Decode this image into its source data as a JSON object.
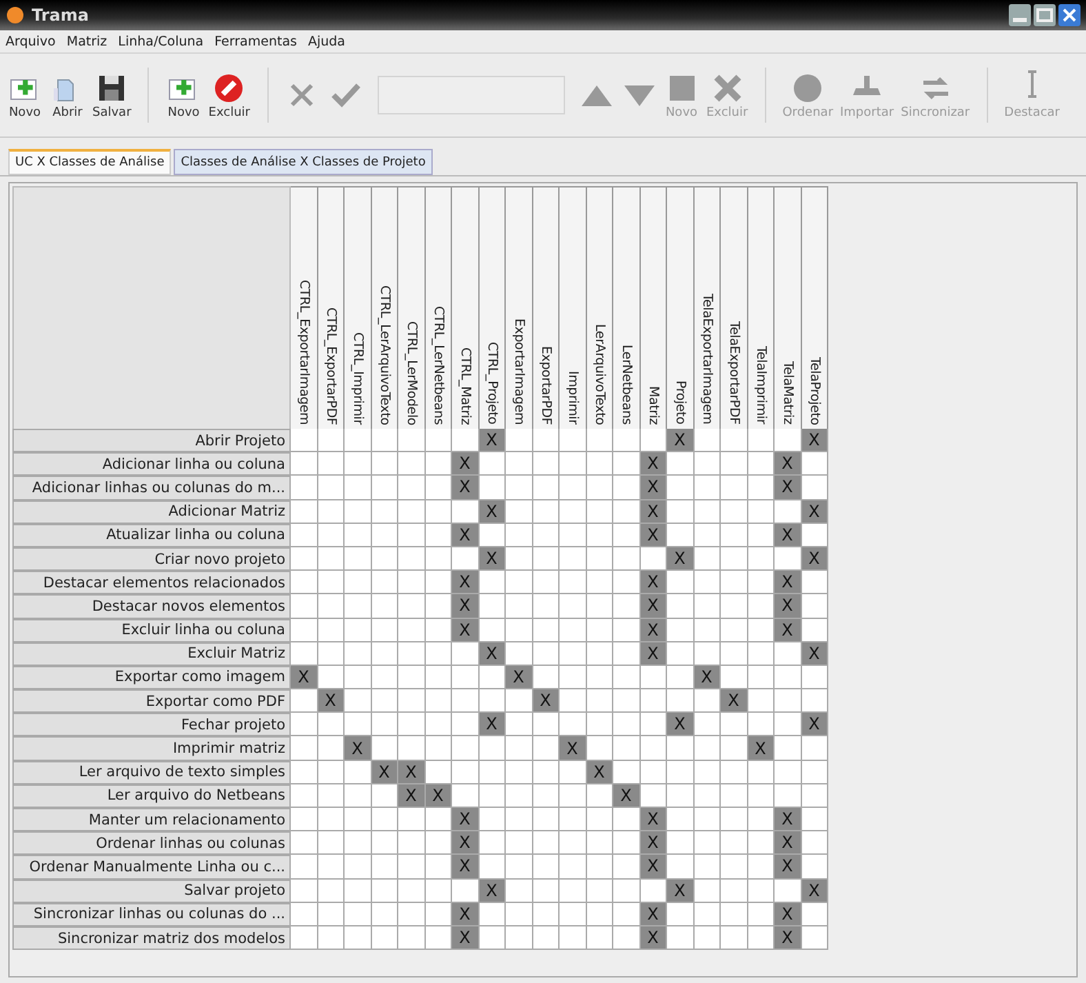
{
  "window": {
    "title": "Trama"
  },
  "menu": [
    "Arquivo",
    "Matriz",
    "Linha/Coluna",
    "Ferramentas",
    "Ajuda"
  ],
  "toolbar": [
    {
      "kind": "button",
      "label": "Novo",
      "disabled": false
    },
    {
      "kind": "button",
      "label": "Abrir",
      "disabled": false
    },
    {
      "kind": "button",
      "label": "Salvar",
      "disabled": false
    },
    {
      "kind": "separator"
    },
    {
      "kind": "button",
      "label": "Novo",
      "disabled": false
    },
    {
      "kind": "button",
      "label": "Excluir",
      "disabled": false
    },
    {
      "kind": "separator"
    },
    {
      "kind": "button",
      "disabled": true
    },
    {
      "kind": "button",
      "disabled": true
    },
    {
      "kind": "field",
      "disabled": true
    },
    {
      "kind": "button",
      "disabled": true
    },
    {
      "kind": "button",
      "disabled": true
    },
    {
      "kind": "button",
      "label": "Novo",
      "disabled": true
    },
    {
      "kind": "button",
      "label": "Excluir",
      "disabled": true
    },
    {
      "kind": "separator"
    },
    {
      "kind": "button",
      "label": "Ordenar",
      "disabled": true
    },
    {
      "kind": "button",
      "label": "Importar",
      "disabled": true
    },
    {
      "kind": "button",
      "label": "Sincronizar",
      "disabled": true
    },
    {
      "kind": "separator"
    },
    {
      "kind": "button",
      "label": "Destacar",
      "disabled": true
    }
  ],
  "tabs": [
    {
      "label": "UC X Classes de Análise",
      "selected": true
    },
    {
      "label": "Classes de Análise X Classes de Projeto",
      "selected": false
    }
  ],
  "matrix": {
    "columns": [
      "CTRL_ExportarImagem",
      "CTRL_ExportarPDF",
      "CTRL_Imprimir",
      "CTRL_LerArquivoTexto",
      "CTRL_LerModelo",
      "CTRL_LerNetbeans",
      "CTRL_Matriz",
      "CTRL_Projeto",
      "ExportarImagem",
      "ExportarPDF",
      "Imprimir",
      "LerArquivoTexto",
      "LerNetbeans",
      "Matriz",
      "Projeto",
      "TelaExportarImagem",
      "TelaExportarPDF",
      "TelaImprimir",
      "TelaMatriz",
      "TelaProjeto"
    ],
    "rows": [
      {
        "label": "Abrir Projeto",
        "cells": [
          {
            "checked": false
          },
          {
            "checked": false
          },
          {
            "checked": false
          },
          {
            "checked": false
          },
          {
            "checked": false
          },
          {
            "checked": false
          },
          {
            "checked": false
          },
          {
            "checked": true,
            "text": "X"
          },
          {
            "checked": false
          },
          {
            "checked": false
          },
          {
            "checked": false
          },
          {
            "checked": false
          },
          {
            "checked": false
          },
          {
            "checked": false
          },
          {
            "checked": true,
            "text": "X"
          },
          {
            "checked": false
          },
          {
            "checked": false
          },
          {
            "checked": false
          },
          {
            "checked": false
          },
          {
            "checked": true,
            "text": "X"
          }
        ]
      },
      {
        "label": "Adicionar linha ou coluna",
        "cells": [
          {
            "checked": false
          },
          {
            "checked": false
          },
          {
            "checked": false
          },
          {
            "checked": false
          },
          {
            "checked": false
          },
          {
            "checked": false
          },
          {
            "checked": true,
            "text": "X"
          },
          {
            "checked": false
          },
          {
            "checked": false
          },
          {
            "checked": false
          },
          {
            "checked": false
          },
          {
            "checked": false
          },
          {
            "checked": false
          },
          {
            "checked": true,
            "text": "X"
          },
          {
            "checked": false
          },
          {
            "checked": false
          },
          {
            "checked": false
          },
          {
            "checked": false
          },
          {
            "checked": true,
            "text": "X"
          },
          {
            "checked": false
          }
        ]
      },
      {
        "label": "Adicionar linhas ou colunas do m...",
        "cells": [
          {
            "checked": false
          },
          {
            "checked": false
          },
          {
            "checked": false
          },
          {
            "checked": false
          },
          {
            "checked": false
          },
          {
            "checked": false
          },
          {
            "checked": true,
            "text": "X"
          },
          {
            "checked": false
          },
          {
            "checked": false
          },
          {
            "checked": false
          },
          {
            "checked": false
          },
          {
            "checked": false
          },
          {
            "checked": false
          },
          {
            "checked": true,
            "text": "X"
          },
          {
            "checked": false
          },
          {
            "checked": false
          },
          {
            "checked": false
          },
          {
            "checked": false
          },
          {
            "checked": true,
            "text": "X"
          },
          {
            "checked": false
          }
        ]
      },
      {
        "label": "Adicionar Matriz",
        "cells": [
          {
            "checked": false
          },
          {
            "checked": false
          },
          {
            "checked": false
          },
          {
            "checked": false
          },
          {
            "checked": false
          },
          {
            "checked": false
          },
          {
            "checked": false
          },
          {
            "checked": true,
            "text": "X"
          },
          {
            "checked": false
          },
          {
            "checked": false
          },
          {
            "checked": false
          },
          {
            "checked": false
          },
          {
            "checked": false
          },
          {
            "checked": true,
            "text": "X"
          },
          {
            "checked": false
          },
          {
            "checked": false
          },
          {
            "checked": false
          },
          {
            "checked": false
          },
          {
            "checked": false
          },
          {
            "checked": true,
            "text": "X"
          }
        ]
      },
      {
        "label": "Atualizar linha ou coluna",
        "cells": [
          {
            "checked": false
          },
          {
            "checked": false
          },
          {
            "checked": false
          },
          {
            "checked": false
          },
          {
            "checked": false
          },
          {
            "checked": false
          },
          {
            "checked": true,
            "text": "X"
          },
          {
            "checked": false
          },
          {
            "checked": false
          },
          {
            "checked": false
          },
          {
            "checked": false
          },
          {
            "checked": false
          },
          {
            "checked": false
          },
          {
            "checked": true,
            "text": "X"
          },
          {
            "checked": false
          },
          {
            "checked": false
          },
          {
            "checked": false
          },
          {
            "checked": false
          },
          {
            "checked": true,
            "text": "X"
          },
          {
            "checked": false
          }
        ]
      },
      {
        "label": "Criar novo projeto",
        "cells": [
          {
            "checked": false
          },
          {
            "checked": false
          },
          {
            "checked": false
          },
          {
            "checked": false
          },
          {
            "checked": false
          },
          {
            "checked": false
          },
          {
            "checked": false
          },
          {
            "checked": true,
            "text": "X"
          },
          {
            "checked": false
          },
          {
            "checked": false
          },
          {
            "checked": false
          },
          {
            "checked": false
          },
          {
            "checked": false
          },
          {
            "checked": false
          },
          {
            "checked": true,
            "text": "X"
          },
          {
            "checked": false
          },
          {
            "checked": false
          },
          {
            "checked": false
          },
          {
            "checked": false
          },
          {
            "checked": true,
            "text": "X"
          }
        ]
      },
      {
        "label": "Destacar elementos relacionados",
        "cells": [
          {
            "checked": false
          },
          {
            "checked": false
          },
          {
            "checked": false
          },
          {
            "checked": false
          },
          {
            "checked": false
          },
          {
            "checked": false
          },
          {
            "checked": true,
            "text": "X"
          },
          {
            "checked": false
          },
          {
            "checked": false
          },
          {
            "checked": false
          },
          {
            "checked": false
          },
          {
            "checked": false
          },
          {
            "checked": false
          },
          {
            "checked": true,
            "text": "X"
          },
          {
            "checked": false
          },
          {
            "checked": false
          },
          {
            "checked": false
          },
          {
            "checked": false
          },
          {
            "checked": true,
            "text": "X"
          },
          {
            "checked": false
          }
        ]
      },
      {
        "label": "Destacar novos elementos",
        "cells": [
          {
            "checked": false
          },
          {
            "checked": false
          },
          {
            "checked": false
          },
          {
            "checked": false
          },
          {
            "checked": false
          },
          {
            "checked": false
          },
          {
            "checked": true,
            "text": "X"
          },
          {
            "checked": false
          },
          {
            "checked": false
          },
          {
            "checked": false
          },
          {
            "checked": false
          },
          {
            "checked": false
          },
          {
            "checked": false
          },
          {
            "checked": true,
            "text": "X"
          },
          {
            "checked": false
          },
          {
            "checked": false
          },
          {
            "checked": false
          },
          {
            "checked": false
          },
          {
            "checked": true,
            "text": "X"
          },
          {
            "checked": false
          }
        ]
      },
      {
        "label": "Excluir linha ou coluna",
        "cells": [
          {
            "checked": false
          },
          {
            "checked": false
          },
          {
            "checked": false
          },
          {
            "checked": false
          },
          {
            "checked": false
          },
          {
            "checked": false
          },
          {
            "checked": true,
            "text": "X"
          },
          {
            "checked": false
          },
          {
            "checked": false
          },
          {
            "checked": false
          },
          {
            "checked": false
          },
          {
            "checked": false
          },
          {
            "checked": false
          },
          {
            "checked": true,
            "text": "X"
          },
          {
            "checked": false
          },
          {
            "checked": false
          },
          {
            "checked": false
          },
          {
            "checked": false
          },
          {
            "checked": true,
            "text": "X"
          },
          {
            "checked": false
          }
        ]
      },
      {
        "label": "Excluir Matriz",
        "cells": [
          {
            "checked": false
          },
          {
            "checked": false
          },
          {
            "checked": false
          },
          {
            "checked": false
          },
          {
            "checked": false
          },
          {
            "checked": false
          },
          {
            "checked": false
          },
          {
            "checked": true,
            "text": "X"
          },
          {
            "checked": false
          },
          {
            "checked": false
          },
          {
            "checked": false
          },
          {
            "checked": false
          },
          {
            "checked": false
          },
          {
            "checked": true,
            "text": "X"
          },
          {
            "checked": false
          },
          {
            "checked": false
          },
          {
            "checked": false
          },
          {
            "checked": false
          },
          {
            "checked": false
          },
          {
            "checked": true,
            "text": "X"
          }
        ]
      },
      {
        "label": "Exportar como imagem",
        "cells": [
          {
            "checked": true,
            "text": "X"
          },
          {
            "checked": false
          },
          {
            "checked": false
          },
          {
            "checked": false
          },
          {
            "checked": false
          },
          {
            "checked": false
          },
          {
            "checked": false
          },
          {
            "checked": false
          },
          {
            "checked": true,
            "text": "X"
          },
          {
            "checked": false
          },
          {
            "checked": false
          },
          {
            "checked": false
          },
          {
            "checked": false
          },
          {
            "checked": false
          },
          {
            "checked": false
          },
          {
            "checked": true,
            "text": "X"
          },
          {
            "checked": false
          },
          {
            "checked": false
          },
          {
            "checked": false
          },
          {
            "checked": false
          }
        ]
      },
      {
        "label": "Exportar como PDF",
        "cells": [
          {
            "checked": false
          },
          {
            "checked": true,
            "text": "X"
          },
          {
            "checked": false
          },
          {
            "checked": false
          },
          {
            "checked": false
          },
          {
            "checked": false
          },
          {
            "checked": false
          },
          {
            "checked": false
          },
          {
            "checked": false
          },
          {
            "checked": true,
            "text": "X"
          },
          {
            "checked": false
          },
          {
            "checked": false
          },
          {
            "checked": false
          },
          {
            "checked": false
          },
          {
            "checked": false
          },
          {
            "checked": false
          },
          {
            "checked": true,
            "text": "X"
          },
          {
            "checked": false
          },
          {
            "checked": false
          },
          {
            "checked": false
          }
        ]
      },
      {
        "label": "Fechar projeto",
        "cells": [
          {
            "checked": false
          },
          {
            "checked": false
          },
          {
            "checked": false
          },
          {
            "checked": false
          },
          {
            "checked": false
          },
          {
            "checked": false
          },
          {
            "checked": false
          },
          {
            "checked": true,
            "text": "X"
          },
          {
            "checked": false
          },
          {
            "checked": false
          },
          {
            "checked": false
          },
          {
            "checked": false
          },
          {
            "checked": false
          },
          {
            "checked": false
          },
          {
            "checked": true,
            "text": "X"
          },
          {
            "checked": false
          },
          {
            "checked": false
          },
          {
            "checked": false
          },
          {
            "checked": false
          },
          {
            "checked": true,
            "text": "X"
          }
        ]
      },
      {
        "label": "Imprimir matriz",
        "cells": [
          {
            "checked": false
          },
          {
            "checked": false
          },
          {
            "checked": true,
            "text": "X"
          },
          {
            "checked": false
          },
          {
            "checked": false
          },
          {
            "checked": false
          },
          {
            "checked": false
          },
          {
            "checked": false
          },
          {
            "checked": false
          },
          {
            "checked": false
          },
          {
            "checked": true,
            "text": "X"
          },
          {
            "checked": false
          },
          {
            "checked": false
          },
          {
            "checked": false
          },
          {
            "checked": false
          },
          {
            "checked": false
          },
          {
            "checked": false
          },
          {
            "checked": true,
            "text": "X"
          },
          {
            "checked": false
          },
          {
            "checked": false
          }
        ]
      },
      {
        "label": "Ler arquivo de texto simples",
        "cells": [
          {
            "checked": false
          },
          {
            "checked": false
          },
          {
            "checked": false
          },
          {
            "checked": true,
            "text": "X"
          },
          {
            "checked": true,
            "text": "X"
          },
          {
            "checked": false
          },
          {
            "checked": false
          },
          {
            "checked": false
          },
          {
            "checked": false
          },
          {
            "checked": false
          },
          {
            "checked": false
          },
          {
            "checked": true,
            "text": "X"
          },
          {
            "checked": false
          },
          {
            "checked": false
          },
          {
            "checked": false
          },
          {
            "checked": false
          },
          {
            "checked": false
          },
          {
            "checked": false
          },
          {
            "checked": false
          },
          {
            "checked": false
          }
        ]
      },
      {
        "label": "Ler arquivo do Netbeans",
        "cells": [
          {
            "checked": false
          },
          {
            "checked": false
          },
          {
            "checked": false
          },
          {
            "checked": false
          },
          {
            "checked": true,
            "text": "X"
          },
          {
            "checked": true,
            "text": "X"
          },
          {
            "checked": false
          },
          {
            "checked": false
          },
          {
            "checked": false
          },
          {
            "checked": false
          },
          {
            "checked": false
          },
          {
            "checked": false
          },
          {
            "checked": true,
            "text": "X"
          },
          {
            "checked": false
          },
          {
            "checked": false
          },
          {
            "checked": false
          },
          {
            "checked": false
          },
          {
            "checked": false
          },
          {
            "checked": false
          },
          {
            "checked": false
          }
        ]
      },
      {
        "label": "Manter um relacionamento",
        "cells": [
          {
            "checked": false
          },
          {
            "checked": false
          },
          {
            "checked": false
          },
          {
            "checked": false
          },
          {
            "checked": false
          },
          {
            "checked": false
          },
          {
            "checked": true,
            "text": "X"
          },
          {
            "checked": false
          },
          {
            "checked": false
          },
          {
            "checked": false
          },
          {
            "checked": false
          },
          {
            "checked": false
          },
          {
            "checked": false
          },
          {
            "checked": true,
            "text": "X"
          },
          {
            "checked": false
          },
          {
            "checked": false
          },
          {
            "checked": false
          },
          {
            "checked": false
          },
          {
            "checked": true,
            "text": "X"
          },
          {
            "checked": false
          }
        ]
      },
      {
        "label": "Ordenar linhas ou colunas",
        "cells": [
          {
            "checked": false
          },
          {
            "checked": false
          },
          {
            "checked": false
          },
          {
            "checked": false
          },
          {
            "checked": false
          },
          {
            "checked": false
          },
          {
            "checked": true,
            "text": "X"
          },
          {
            "checked": false
          },
          {
            "checked": false
          },
          {
            "checked": false
          },
          {
            "checked": false
          },
          {
            "checked": false
          },
          {
            "checked": false
          },
          {
            "checked": true,
            "text": "X"
          },
          {
            "checked": false
          },
          {
            "checked": false
          },
          {
            "checked": false
          },
          {
            "checked": false
          },
          {
            "checked": true,
            "text": "X"
          },
          {
            "checked": false
          }
        ]
      },
      {
        "label": "Ordenar Manualmente Linha ou c...",
        "cells": [
          {
            "checked": false
          },
          {
            "checked": false
          },
          {
            "checked": false
          },
          {
            "checked": false
          },
          {
            "checked": false
          },
          {
            "checked": false
          },
          {
            "checked": true,
            "text": "X"
          },
          {
            "checked": false
          },
          {
            "checked": false
          },
          {
            "checked": false
          },
          {
            "checked": false
          },
          {
            "checked": false
          },
          {
            "checked": false
          },
          {
            "checked": true,
            "text": "X"
          },
          {
            "checked": false
          },
          {
            "checked": false
          },
          {
            "checked": false
          },
          {
            "checked": false
          },
          {
            "checked": true,
            "text": "X"
          },
          {
            "checked": false
          }
        ]
      },
      {
        "label": "Salvar projeto",
        "cells": [
          {
            "checked": false
          },
          {
            "checked": false
          },
          {
            "checked": false
          },
          {
            "checked": false
          },
          {
            "checked": false
          },
          {
            "checked": false
          },
          {
            "checked": false
          },
          {
            "checked": true,
            "text": "X"
          },
          {
            "checked": false
          },
          {
            "checked": false
          },
          {
            "checked": false
          },
          {
            "checked": false
          },
          {
            "checked": false
          },
          {
            "checked": false
          },
          {
            "checked": true,
            "text": "X"
          },
          {
            "checked": false
          },
          {
            "checked": false
          },
          {
            "checked": false
          },
          {
            "checked": false
          },
          {
            "checked": true,
            "text": "X"
          }
        ]
      },
      {
        "label": "Sincronizar linhas ou colunas do ...",
        "cells": [
          {
            "checked": false
          },
          {
            "checked": false
          },
          {
            "checked": false
          },
          {
            "checked": false
          },
          {
            "checked": false
          },
          {
            "checked": false
          },
          {
            "checked": true,
            "text": "X"
          },
          {
            "checked": false
          },
          {
            "checked": false
          },
          {
            "checked": false
          },
          {
            "checked": false
          },
          {
            "checked": false
          },
          {
            "checked": false
          },
          {
            "checked": true,
            "text": "X"
          },
          {
            "checked": false
          },
          {
            "checked": false
          },
          {
            "checked": false
          },
          {
            "checked": false
          },
          {
            "checked": true,
            "text": "X"
          },
          {
            "checked": false
          }
        ]
      },
      {
        "label": "Sincronizar matriz dos modelos",
        "cells": [
          {
            "checked": false
          },
          {
            "checked": false
          },
          {
            "checked": false
          },
          {
            "checked": false
          },
          {
            "checked": false
          },
          {
            "checked": false
          },
          {
            "checked": true,
            "text": "X"
          },
          {
            "checked": false
          },
          {
            "checked": false
          },
          {
            "checked": false
          },
          {
            "checked": false
          },
          {
            "checked": false
          },
          {
            "checked": false
          },
          {
            "checked": true,
            "text": "X"
          },
          {
            "checked": false
          },
          {
            "checked": false
          },
          {
            "checked": false
          },
          {
            "checked": false
          },
          {
            "checked": true,
            "text": "X"
          },
          {
            "checked": false
          }
        ]
      }
    ]
  }
}
